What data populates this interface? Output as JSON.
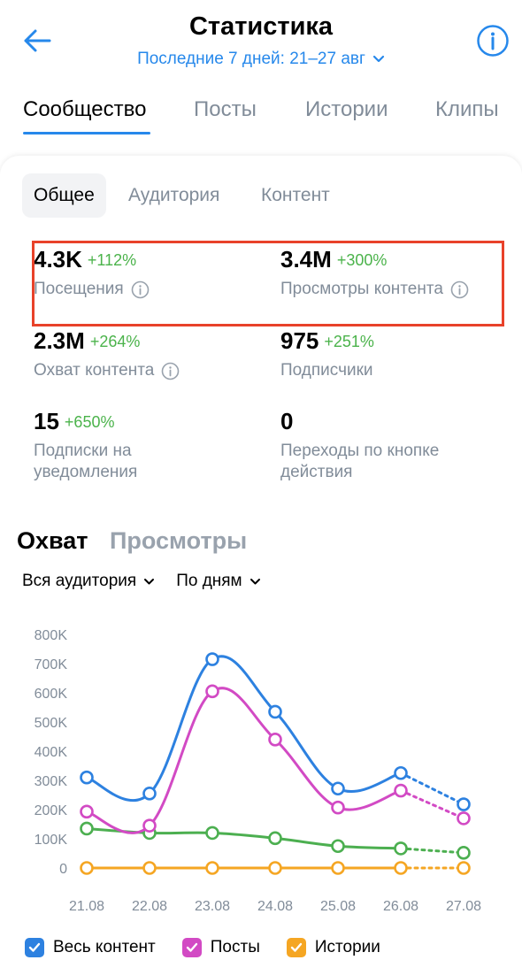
{
  "header": {
    "title": "Статистика",
    "period": "Последние 7 дней: 21–27 авг",
    "back_icon": "arrow-left-icon",
    "info_icon": "info-icon"
  },
  "main_tabs": [
    {
      "label": "Сообщество",
      "active": true
    },
    {
      "label": "Посты",
      "active": false
    },
    {
      "label": "Истории",
      "active": false
    },
    {
      "label": "Клипы",
      "active": false
    }
  ],
  "sub_tabs": [
    {
      "label": "Общее",
      "active": true
    },
    {
      "label": "Аудитория",
      "active": false
    },
    {
      "label": "Контент",
      "active": false
    }
  ],
  "stats": [
    {
      "value": "4.3K",
      "growth": "+112%",
      "label": "Посещения",
      "has_info": true
    },
    {
      "value": "3.4M",
      "growth": "+300%",
      "label": "Просмотры контента",
      "has_info": true
    },
    {
      "value": "2.3M",
      "growth": "+264%",
      "label": "Охват контента",
      "has_info": true
    },
    {
      "value": "975",
      "growth": "+251%",
      "label": "Подписчики",
      "has_info": false
    },
    {
      "value": "15",
      "growth": "+650%",
      "label": "Подписки на уведомления",
      "has_info": false
    },
    {
      "value": "0",
      "growth": "",
      "label": "Переходы по кнопке действия",
      "has_info": false
    }
  ],
  "section_tabs": [
    {
      "label": "Охват",
      "active": true
    },
    {
      "label": "Просмотры",
      "active": false
    }
  ],
  "filters": [
    {
      "label": "Вся аудитория"
    },
    {
      "label": "По дням"
    }
  ],
  "legend": [
    {
      "label": "Весь контент",
      "color": "#2d81e0"
    },
    {
      "label": "Посты",
      "color": "#d24ac4"
    },
    {
      "label": "Истории",
      "color": "#f5a623"
    }
  ],
  "colors": {
    "accent": "#2688eb",
    "growth": "#4bb34b",
    "highlight": "#e8422a",
    "muted": "#818c99"
  },
  "chart_data": {
    "type": "line",
    "categories": [
      "21.08",
      "22.08",
      "23.08",
      "24.08",
      "25.08",
      "26.08",
      "27.08"
    ],
    "y_tick_labels": [
      "0",
      "100K",
      "200K",
      "300K",
      "400K",
      "500K",
      "600K",
      "700K",
      "800K"
    ],
    "ylim": [
      0,
      800000
    ],
    "grid": false,
    "projected_from_index": 5,
    "series": [
      {
        "name": "Весь контент",
        "color": "#2d81e0",
        "values": [
          310000,
          255000,
          715000,
          535000,
          272000,
          325000,
          218000
        ]
      },
      {
        "name": "Посты",
        "color": "#d24ac4",
        "values": [
          193000,
          145000,
          605000,
          440000,
          207000,
          265000,
          170000
        ]
      },
      {
        "name": "",
        "color": "#4caf50",
        "values": [
          135000,
          120000,
          120000,
          102000,
          75000,
          67000,
          52000
        ]
      },
      {
        "name": "Истории",
        "color": "#f5a623",
        "values": [
          0,
          0,
          0,
          0,
          0,
          0,
          0
        ]
      }
    ]
  }
}
